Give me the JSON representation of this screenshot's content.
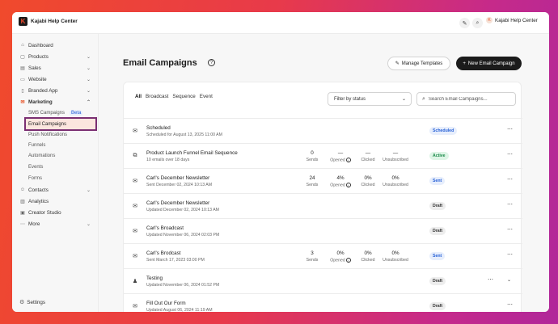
{
  "app": {
    "brand": "Kajabi Help Center",
    "site_label": "Kajabi Help Center",
    "site_initial": "K"
  },
  "icons": {
    "edit": "pencil-icon",
    "search": "search-icon"
  },
  "sidebar": {
    "items": [
      {
        "label": "Dashboard",
        "icon": "home-icon"
      },
      {
        "label": "Products",
        "icon": "box-icon",
        "chevron": "down"
      },
      {
        "label": "Sales",
        "icon": "cart-icon",
        "chevron": "down"
      },
      {
        "label": "Website",
        "icon": "globe-icon",
        "chevron": "down"
      },
      {
        "label": "Branded App",
        "icon": "phone-icon",
        "chevron": "down"
      },
      {
        "label": "Marketing",
        "icon": "mail-icon",
        "chevron": "up"
      }
    ],
    "marketing_sub": [
      {
        "label": "SMS Campaigns",
        "badge": "Beta"
      },
      {
        "label": "Email Campaigns"
      },
      {
        "label": "Push Notifications"
      },
      {
        "label": "Funnels"
      },
      {
        "label": "Automations"
      },
      {
        "label": "Events"
      },
      {
        "label": "Forms"
      }
    ],
    "items_after": [
      {
        "label": "Contacts",
        "icon": "person-icon",
        "chevron": "down"
      },
      {
        "label": "Analytics",
        "icon": "chart-icon"
      },
      {
        "label": "Creator Studio",
        "icon": "studio-icon"
      },
      {
        "label": "More",
        "icon": "dots-icon",
        "chevron": "down"
      }
    ],
    "settings": "Settings"
  },
  "main": {
    "title": "Email Campaigns",
    "manage_templates": "Manage Templates",
    "new_campaign": "New Email Campaign",
    "tabs": [
      "All",
      "Broadcast",
      "Sequence",
      "Event"
    ],
    "filter_placeholder": "Filter by status",
    "search_placeholder": "Search Email Campaigns...",
    "stat_labels": {
      "sends": "Sends",
      "opened": "Opened",
      "clicked": "Clicked",
      "unsubscribed": "Unsubscribed"
    },
    "rows": [
      {
        "name": "Scheduled",
        "sub": "Scheduled for August 13, 2025 11:00 AM",
        "icon": "mail-icon",
        "status": "Scheduled",
        "stats": null
      },
      {
        "name": "Product Launch Funnel Email Sequence",
        "sub": "10 emails over 18 days",
        "icon": "sequence-icon",
        "status": "Active",
        "stats": {
          "sends": "0",
          "opened": "—",
          "clicked": "—",
          "unsubscribed": "—"
        }
      },
      {
        "name": "Carl's December Newsletter",
        "sub": "Sent December 02, 2024 10:13 AM",
        "icon": "mail-icon",
        "status": "Sent",
        "stats": {
          "sends": "24",
          "opened": "4%",
          "clicked": "0%",
          "unsubscribed": "0%"
        }
      },
      {
        "name": "Carl's December Newsletter",
        "sub": "Updated December 02, 2024 10:13 AM",
        "icon": "mail-icon",
        "status": "Draft",
        "stats": null
      },
      {
        "name": "Carl's Broadcast",
        "sub": "Updated November 06, 2024 02:03 PM",
        "icon": "mail-icon",
        "status": "Draft",
        "stats": null
      },
      {
        "name": "Carl's Brodcast",
        "sub": "Sent March 17, 2023 03:00 PM",
        "icon": "mail-icon",
        "status": "Sent",
        "stats": {
          "sends": "3",
          "opened": "0%",
          "clicked": "0%",
          "unsubscribed": "0%"
        }
      },
      {
        "name": "Testing",
        "sub": "Updated November 06, 2024 01:52 PM",
        "icon": "event-icon",
        "status": "Draft",
        "stats": null,
        "expandable": true
      },
      {
        "name": "Fill Out Our Form",
        "sub": "Updated August 06, 2024 11:19 AM",
        "icon": "mail-icon",
        "status": "Draft",
        "stats": null
      }
    ]
  },
  "colors": {
    "accent": "#e8562a",
    "highlight_outline": "#7a2f72",
    "badge_scheduled_bg": "#e7eefc",
    "badge_scheduled_fg": "#245fd6",
    "badge_active_bg": "#def5e6",
    "badge_active_fg": "#1b8a4a",
    "badge_sent_bg": "#e7eefc",
    "badge_sent_fg": "#245fd6",
    "badge_draft_bg": "#ededed",
    "badge_draft_fg": "#333333"
  }
}
